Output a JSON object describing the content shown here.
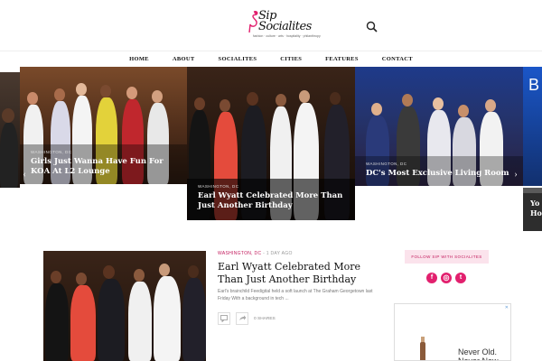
{
  "header": {
    "logo_text": "Sip\nSocialites",
    "logo_tagline": "fashion · culture · arts · hospitality · philanthropy"
  },
  "nav": {
    "items": [
      "HOME",
      "ABOUT",
      "SOCIALITES",
      "CITIES",
      "FEATURES",
      "CONTACT"
    ]
  },
  "slider": {
    "slides": [
      {
        "location": "WASHINGTON, DC",
        "title": "Girls Just Wanna Have Fun For KOA At L2 Lounge"
      },
      {
        "location": "WASHINGTON, DC",
        "title": "Earl Wyatt Celebrated More Than Just Another Birthday"
      },
      {
        "location": "WASHINGTON, DC",
        "title": "DC's Most Exclusive Living Room"
      },
      {
        "location": "",
        "title": "Yo Ho"
      }
    ],
    "prev_arrow": "‹",
    "next_arrow": "›"
  },
  "post": {
    "location": "WASHINGTON, DC",
    "separator": " - ",
    "time_ago": "1 DAY AGO",
    "title": "Earl Wyatt Celebrated More Than Just Another Birthday",
    "excerpt": "Earl's brainchild Feedigital held a soft launch at The Graham Georgetown last Friday With a background in tech ...",
    "shares": "0 SHARES"
  },
  "sidebar": {
    "follow_label": "FOLLOW SIP WITH SOCIALITES",
    "socials": [
      {
        "name": "facebook",
        "glyph": "f"
      },
      {
        "name": "instagram",
        "glyph": "◎"
      },
      {
        "name": "twitter",
        "glyph": "t"
      }
    ],
    "ad": {
      "close": "✕",
      "text": "Never Old.\nNever Now"
    }
  },
  "colors": {
    "accent_pink": "#c2185b",
    "social_pink": "#e2206e",
    "follow_bg": "#fbe3ec"
  }
}
